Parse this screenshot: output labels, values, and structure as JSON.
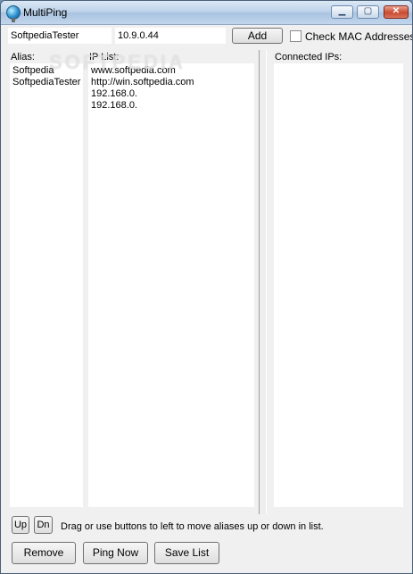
{
  "window": {
    "title": "MultiPing",
    "buttons": {
      "minimize": "▁",
      "maximize": "▢",
      "close": "✕"
    },
    "app_icon": "globe-icon"
  },
  "form": {
    "alias_value": "SoftpediaTester",
    "ip_value": "10.9.0.44",
    "add_label": "Add",
    "check_mac_label": "Check MAC Addresses",
    "check_mac_checked": false
  },
  "lists": {
    "alias_label": "Alias:",
    "ip_label": "IP List:",
    "connected_label": "Connected IPs:",
    "aliases": [
      "Softpedia",
      "SoftpediaTester"
    ],
    "ips": [
      "www.softpedia.com",
      "http://win.softpedia.com",
      "192.168.0.",
      "192.168.0."
    ],
    "connected": []
  },
  "move": {
    "up_label": "Up",
    "down_label": "Dn",
    "hint": "Drag or use buttons to left to move aliases up or down in list."
  },
  "actions": {
    "remove_label": "Remove",
    "ping_now_label": "Ping Now",
    "save_list_label": "Save List"
  },
  "watermark": "SOFTPEDIA"
}
